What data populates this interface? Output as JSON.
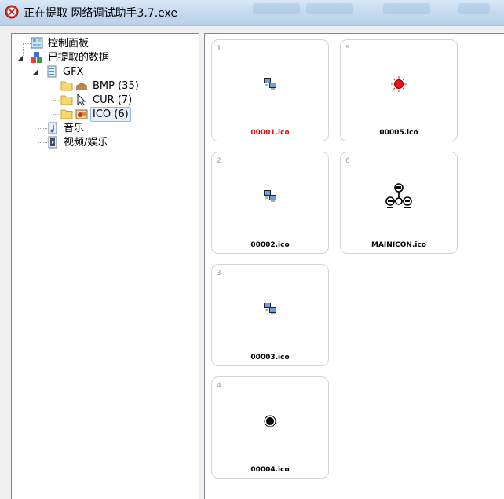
{
  "window": {
    "title": "正在提取 网络调试助手3.7.exe"
  },
  "tree": {
    "items": [
      {
        "label": "控制面板",
        "icon": "control-panel-icon"
      },
      {
        "label": "已提取的数据",
        "icon": "extracted-data-icon"
      },
      {
        "label": "GFX",
        "icon": "gfx-icon"
      },
      {
        "label": "BMP (35)",
        "icon": "folder-icon"
      },
      {
        "label": "CUR (7)",
        "icon": "folder-icon"
      },
      {
        "label": "ICO (6)",
        "icon": "folder-icon",
        "selected": true
      },
      {
        "label": "音乐",
        "icon": "music-icon"
      },
      {
        "label": "视频/娱乐",
        "icon": "video-icon"
      }
    ]
  },
  "grid": {
    "cards": [
      {
        "num": "1",
        "name": "00001.ico",
        "thumb": "network-computers-icon",
        "highlight": true
      },
      {
        "num": "5",
        "name": "00005.ico",
        "thumb": "red-dot-icon"
      },
      {
        "num": "2",
        "name": "00002.ico",
        "thumb": "network-computers-icon"
      },
      {
        "num": "6",
        "name": "MAINICON.ico",
        "thumb": "network-nodes-icon"
      },
      {
        "num": "3",
        "name": "00003.ico",
        "thumb": "network-computers-icon"
      },
      {
        "num": "4",
        "name": "00004.ico",
        "thumb": "black-dot-icon"
      }
    ]
  }
}
